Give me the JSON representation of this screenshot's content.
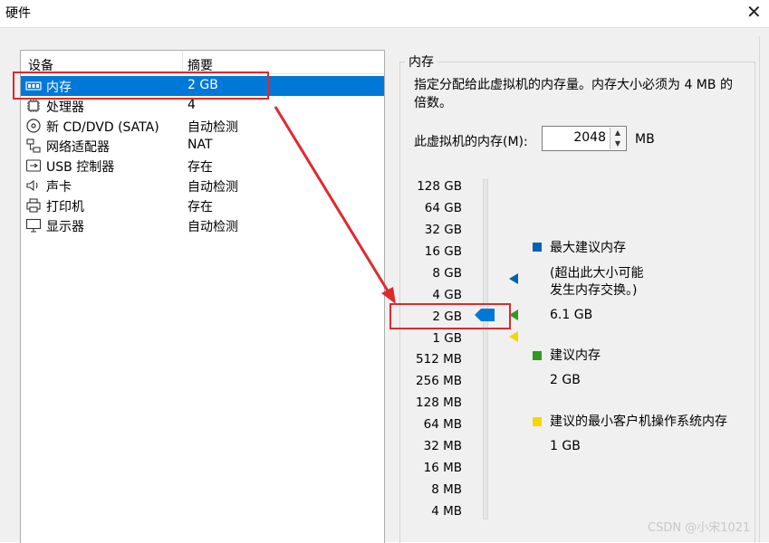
{
  "window": {
    "title": "硬件"
  },
  "device_list": {
    "col_device": "设备",
    "col_summary": "摘要",
    "rows": [
      {
        "name": "内存",
        "summary": "2 GB",
        "icon": "memory-icon",
        "selected": true
      },
      {
        "name": "处理器",
        "summary": "4",
        "icon": "cpu-icon"
      },
      {
        "name": "新 CD/DVD (SATA)",
        "summary": "自动检测",
        "icon": "cd-dvd-icon"
      },
      {
        "name": "网络适配器",
        "summary": "NAT",
        "icon": "network-adapter-icon"
      },
      {
        "name": "USB 控制器",
        "summary": "存在",
        "icon": "usb-icon"
      },
      {
        "name": "声卡",
        "summary": "自动检测",
        "icon": "speaker-icon"
      },
      {
        "name": "打印机",
        "summary": "存在",
        "icon": "printer-icon"
      },
      {
        "name": "显示器",
        "summary": "自动检测",
        "icon": "monitor-icon"
      }
    ]
  },
  "memory": {
    "group_title": "内存",
    "description": "指定分配给此虚拟机的内存量。内存大小必须为 4 MB 的倍数。",
    "input_label": "此虚拟机的内存(M):",
    "input_value": "2048",
    "unit": "MB",
    "scale": [
      "128 GB",
      "64 GB",
      "32 GB",
      "16 GB",
      "8 GB",
      "4 GB",
      "2 GB",
      "1 GB",
      "512 MB",
      "256 MB",
      "128 MB",
      "64 MB",
      "32 MB",
      "16 MB",
      "8 MB",
      "4 MB"
    ],
    "current_level": "2 GB",
    "colors": {
      "max": "#0063b1",
      "recommended": "#2e9b1f",
      "min_guest": "#f5d700",
      "selection": "#0078d7",
      "annotation": "#e0282f"
    },
    "legend": {
      "max_title": "最大建议内存",
      "max_note_1": "(超出此大小可能",
      "max_note_2": "发生内存交换。)",
      "max_value": "6.1 GB",
      "rec_title": "建议内存",
      "rec_value": "2 GB",
      "min_title": "建议的最小客户机操作系统内存",
      "min_value": "1 GB"
    }
  },
  "watermark": "CSDN @小宋1021"
}
